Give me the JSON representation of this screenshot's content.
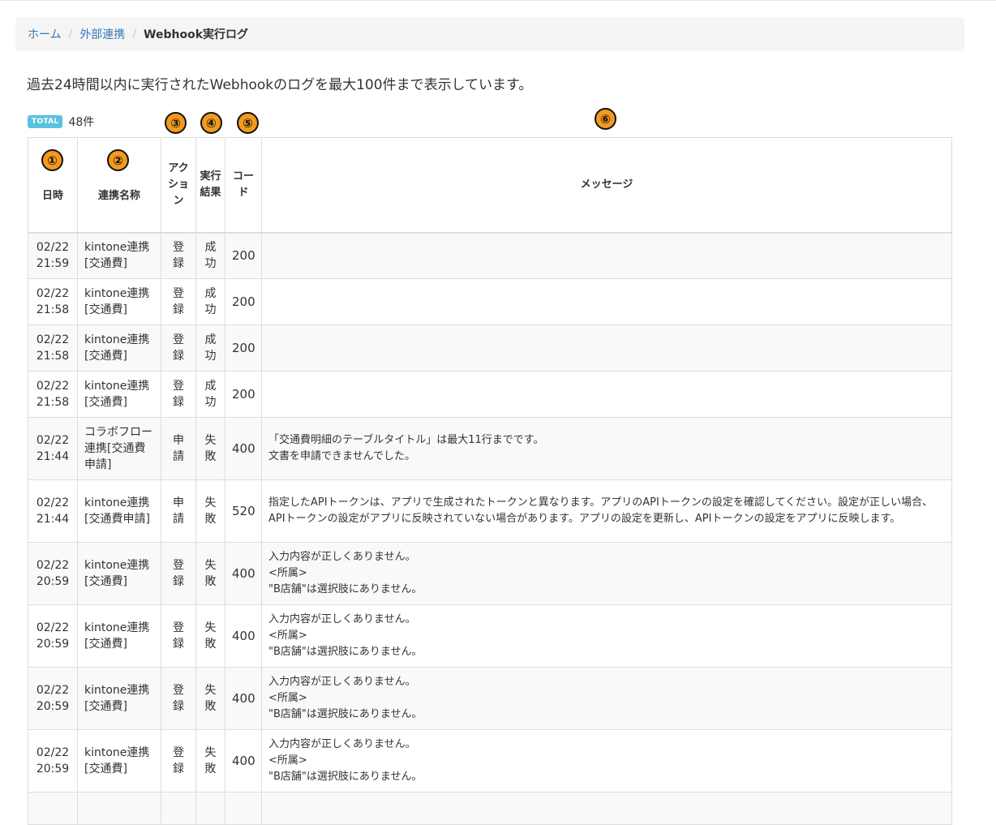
{
  "breadcrumb": {
    "home": "ホーム",
    "integration": "外部連携",
    "current": "Webhook実行ログ",
    "separator": "/"
  },
  "description": "過去24時間以内に実行されたWebhookのログを最大100件まで表示しています。",
  "total": {
    "badge": "TOTAL",
    "count": "48件"
  },
  "markers": [
    "①",
    "②",
    "③",
    "④",
    "⑤",
    "⑥"
  ],
  "table": {
    "headers": {
      "date": "日時",
      "name": "連携名称",
      "action": "アクション",
      "result": "実行結果",
      "code": "コード",
      "message": "メッセージ"
    },
    "rows": [
      {
        "date": "02/22",
        "time": "21:59",
        "name": "kintone連携[交通費]",
        "action": "登録",
        "result": "成功",
        "code": "200",
        "message": ""
      },
      {
        "date": "02/22",
        "time": "21:58",
        "name": "kintone連携[交通費]",
        "action": "登録",
        "result": "成功",
        "code": "200",
        "message": ""
      },
      {
        "date": "02/22",
        "time": "21:58",
        "name": "kintone連携[交通費]",
        "action": "登録",
        "result": "成功",
        "code": "200",
        "message": ""
      },
      {
        "date": "02/22",
        "time": "21:58",
        "name": "kintone連携[交通費]",
        "action": "登録",
        "result": "成功",
        "code": "200",
        "message": ""
      },
      {
        "date": "02/22",
        "time": "21:44",
        "name": "コラボフロー連携[交通費申請]",
        "action": "申請",
        "result": "失敗",
        "code": "400",
        "message": "「交通費明細のテーブルタイトル」は最大11行までです。\n文書を申請できませんでした。"
      },
      {
        "date": "02/22",
        "time": "21:44",
        "name": "kintone連携[交通費申請]",
        "action": "申請",
        "result": "失敗",
        "code": "520",
        "message": "指定したAPIトークンは、アプリで生成されたトークンと異なります。アプリのAPIトークンの設定を確認してください。設定が正しい場合、APIトークンの設定がアプリに反映されていない場合があります。アプリの設定を更新し、APIトークンの設定をアプリに反映します。"
      },
      {
        "date": "02/22",
        "time": "20:59",
        "name": "kintone連携[交通費]",
        "action": "登録",
        "result": "失敗",
        "code": "400",
        "message": "入力内容が正しくありません。\n<所属>\n\"B店舗\"は選択肢にありません。"
      },
      {
        "date": "02/22",
        "time": "20:59",
        "name": "kintone連携[交通費]",
        "action": "登録",
        "result": "失敗",
        "code": "400",
        "message": "入力内容が正しくありません。\n<所属>\n\"B店舗\"は選択肢にありません。"
      },
      {
        "date": "02/22",
        "time": "20:59",
        "name": "kintone連携[交通費]",
        "action": "登録",
        "result": "失敗",
        "code": "400",
        "message": "入力内容が正しくありません。\n<所属>\n\"B店舗\"は選択肢にありません。"
      },
      {
        "date": "02/22",
        "time": "20:59",
        "name": "kintone連携[交通費]",
        "action": "登録",
        "result": "失敗",
        "code": "400",
        "message": "入力内容が正しくありません。\n<所属>\n\"B店舗\"は選択肢にありません。"
      },
      {
        "date": "",
        "time": "",
        "name": "",
        "action": "",
        "result": "",
        "code": "",
        "message": ""
      }
    ]
  },
  "colors": {
    "link": "#337ab7",
    "badge": "#5bc0de",
    "marker": "#f39a1e",
    "stripe": "#f9f9f9",
    "border": "#dddddd"
  }
}
